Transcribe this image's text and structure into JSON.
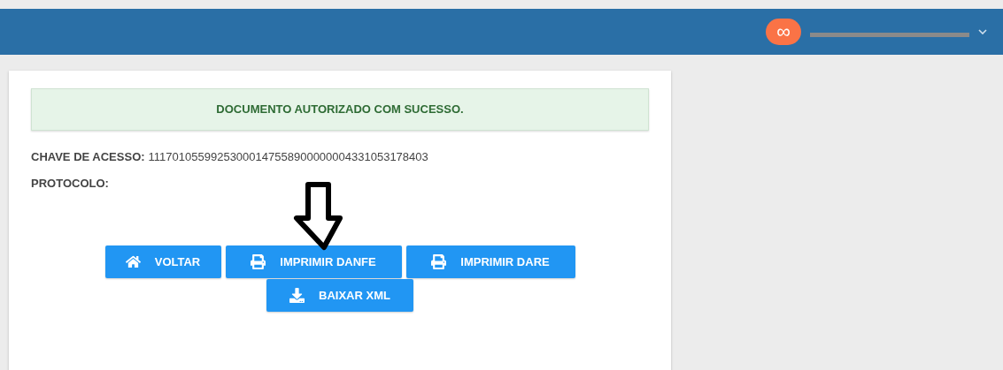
{
  "header": {
    "avatar_icon": "∞"
  },
  "alert": {
    "message": "DOCUMENTO AUTORIZADO COM SUCESSO."
  },
  "fields": [
    {
      "label": "CHAVE DE ACESSO:",
      "value": "11170105599253000147558900000004331053178403"
    },
    {
      "label": "PROTOCOLO:"
    }
  ],
  "buttons": [
    {
      "label": "VOLTAR",
      "kind": "home"
    },
    {
      "label": "IMPRIMIR DANFE",
      "kind": "print"
    },
    {
      "label": "IMPRIMIR DARE",
      "kind": "print"
    },
    {
      "label": "BAIXAR XML",
      "kind": "download"
    }
  ]
}
